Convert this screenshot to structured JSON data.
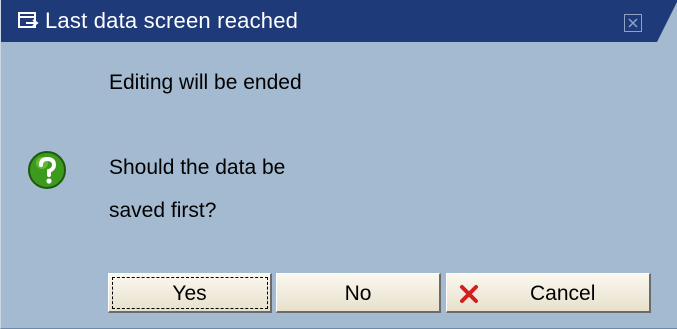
{
  "window": {
    "title": "Last data screen reached"
  },
  "message": {
    "line1": "Editing will be ended",
    "line2": "Should the data be",
    "line3": "saved first?"
  },
  "buttons": {
    "yes": "Yes",
    "no": "No",
    "cancel": "Cancel"
  },
  "icons": {
    "title": "window-icon",
    "close": "close-icon",
    "question": "question-icon",
    "cancel": "cancel-x-icon"
  },
  "colors": {
    "titlebar": "#1f3a78",
    "background": "#a3bad0",
    "button_face": "#f3efe2",
    "question_green": "#3c9a1e",
    "cancel_red": "#d21f1f"
  }
}
